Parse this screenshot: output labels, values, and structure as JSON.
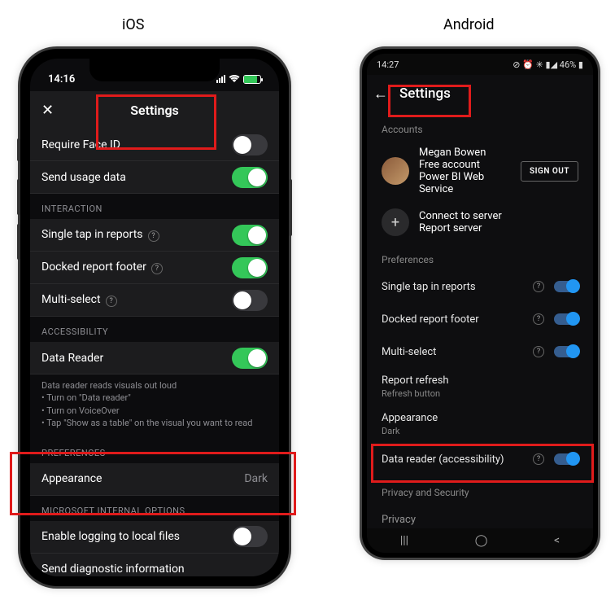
{
  "labels": {
    "ios": "iOS",
    "android": "Android"
  },
  "ios": {
    "time": "14:16",
    "titlebar": {
      "title": "Settings",
      "close": "✕"
    },
    "rows": {
      "require_faceid": "Require Face ID",
      "send_usage": "Send usage data"
    },
    "sections": {
      "interaction": "INTERACTION",
      "accessibility": "ACCESSIBILITY",
      "preferences": "PREFERENCES",
      "internal": "MICROSOFT INTERNAL OPTIONS"
    },
    "interaction": {
      "single_tap": "Single tap in reports",
      "docked_footer": "Docked report footer",
      "multi_select": "Multi-select"
    },
    "accessibility": {
      "data_reader": "Data Reader",
      "hint": "Data reader reads visuals out loud\n• Turn on \"Data reader\"\n• Turn on VoiceOver\n• Tap \"Show as a table\" on the visual you want to read"
    },
    "preferences": {
      "appearance_label": "Appearance",
      "appearance_value": "Dark"
    },
    "internal": {
      "enable_logging": "Enable logging to local files",
      "send_diag": "Send diagnostic information"
    }
  },
  "android": {
    "time": "14:27",
    "battery": "46%",
    "title": "Settings",
    "sections": {
      "accounts": "Accounts",
      "preferences": "Preferences",
      "privacy": "Privacy and Security"
    },
    "account": {
      "name": "Megan Bowen",
      "sub1": "Free account",
      "sub2": "Power BI Web Service",
      "signout": "SIGN OUT",
      "connect": "Connect to server",
      "connect_sub": "Report server"
    },
    "prefs": {
      "single_tap": "Single tap in reports",
      "docked_footer": "Docked report footer",
      "multi_select": "Multi-select",
      "report_refresh": "Report refresh",
      "report_refresh_sub": "Refresh button",
      "appearance": "Appearance",
      "appearance_sub": "Dark",
      "data_reader": "Data reader (accessibility)"
    },
    "privacy_row": "Privacy"
  }
}
